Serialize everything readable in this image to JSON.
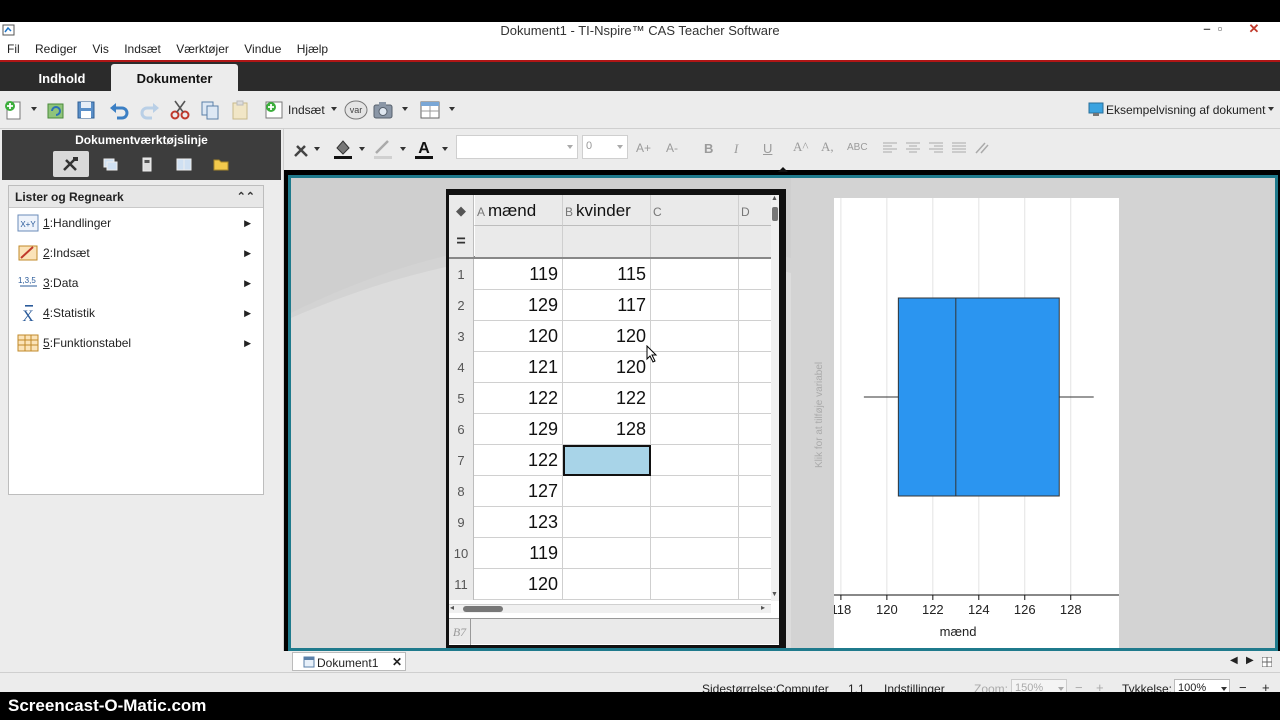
{
  "window": {
    "title": "Dokument1 - TI-Nspire™ CAS Teacher Software",
    "minimize_glyph": "–",
    "maximize_glyph": "▫",
    "close_glyph": "✕"
  },
  "menu": [
    "Fil",
    "Rediger",
    "Vis",
    "Indsæt",
    "Værktøjer",
    "Vindue",
    "Hjælp"
  ],
  "tabs": {
    "content": "Indhold",
    "documents": "Dokumenter"
  },
  "toolbar": {
    "insert_label": "Indsæt",
    "var_label": "var",
    "preview_label": "Eksempelvisning af dokument"
  },
  "left_pane": {
    "title": "Dokumentværktøjslinje",
    "box_title": "Lister og Regneark",
    "items": [
      {
        "num": "1",
        "label": "Handlinger",
        "icon": "actions-icon"
      },
      {
        "num": "2",
        "label": "Indsæt",
        "icon": "insert-icon"
      },
      {
        "num": "3",
        "label": "Data",
        "icon": "data-icon"
      },
      {
        "num": "4",
        "label": "Statistik",
        "icon": "statistics-icon"
      },
      {
        "num": "5",
        "label": "Funktionstabel",
        "icon": "table-icon"
      }
    ]
  },
  "format_bar": {
    "font_size_value": "0",
    "buttons": [
      "B",
      "I",
      "U"
    ]
  },
  "spreadsheet": {
    "columns": [
      {
        "letter": "A",
        "name": "mænd"
      },
      {
        "letter": "B",
        "name": "kvinder"
      },
      {
        "letter": "C",
        "name": ""
      },
      {
        "letter": "D",
        "name": ""
      }
    ],
    "formula_row_label": "=",
    "rows": [
      {
        "n": "1",
        "a": "119",
        "b": "115"
      },
      {
        "n": "2",
        "a": "129",
        "b": "117"
      },
      {
        "n": "3",
        "a": "120",
        "b": "120"
      },
      {
        "n": "4",
        "a": "121",
        "b": "120"
      },
      {
        "n": "5",
        "a": "122",
        "b": "122"
      },
      {
        "n": "6",
        "a": "129",
        "b": "128"
      },
      {
        "n": "7",
        "a": "122",
        "b": ""
      },
      {
        "n": "8",
        "a": "127",
        "b": ""
      },
      {
        "n": "9",
        "a": "123",
        "b": ""
      },
      {
        "n": "10",
        "a": "119",
        "b": ""
      },
      {
        "n": "11",
        "a": "120",
        "b": ""
      }
    ],
    "selected_cell": "B7",
    "entry_ref": "B7"
  },
  "chart_data": {
    "type": "boxplot",
    "xlabel": "mænd",
    "y_axis_prompt": "Klik for at tilføje variabel",
    "x_ticks": [
      118,
      120,
      122,
      124,
      126,
      128
    ],
    "xlim": [
      117.7,
      130.1
    ],
    "min": 119,
    "q1": 120.5,
    "median": 123,
    "q3": 127.5,
    "max": 129,
    "box_color": "#2b95f0"
  },
  "doc_tab": {
    "label": "Dokument1",
    "close": "✕"
  },
  "status": {
    "page_size": "Sidestørrelse:Computer",
    "page_num": "1.1",
    "settings": "Indstillinger",
    "zoom_label": "Zoom:",
    "zoom_value": "150%",
    "thickness_label": "Tykkelse:",
    "thickness_value": "100%"
  },
  "watermark": "Screencast-O-Matic.com"
}
